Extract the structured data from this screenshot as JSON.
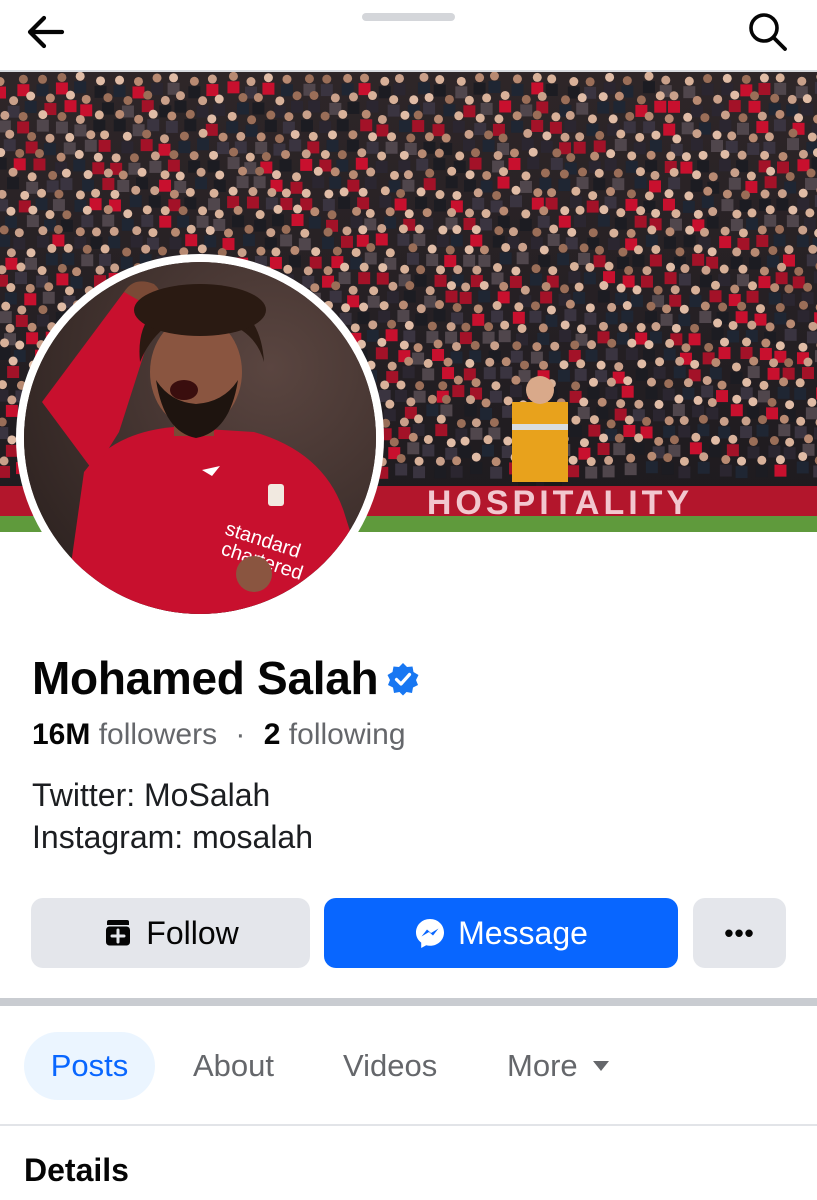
{
  "header": {
    "back_icon": "arrow-left-icon",
    "search_icon": "search-icon"
  },
  "cover": {
    "description_icon": "stadium-crowd-photo",
    "banner_text": "HOSPITALITY"
  },
  "profile": {
    "name": "Mohamed Salah",
    "verified_icon": "verified-badge-icon",
    "followers_count": "16M",
    "followers_label": "followers",
    "separator": "·",
    "following_count": "2",
    "following_label": "following",
    "bio": [
      "Twitter: MoSalah",
      "Instagram: mosalah"
    ]
  },
  "actions": {
    "follow_label": "Follow",
    "follow_icon": "follow-add-icon",
    "message_label": "Message",
    "message_icon": "messenger-icon",
    "more_label": "•••"
  },
  "tabs": [
    {
      "label": "Posts",
      "active": true
    },
    {
      "label": "About",
      "active": false
    },
    {
      "label": "Videos",
      "active": false
    },
    {
      "label": "More",
      "active": false
    }
  ],
  "section": {
    "title": "Details"
  },
  "colors": {
    "accent": "#0866ff",
    "verified": "#1877f2",
    "button_gray": "#e4e6eb",
    "tab_active_bg": "#ebf5ff",
    "jersey_red": "#c8102e"
  }
}
